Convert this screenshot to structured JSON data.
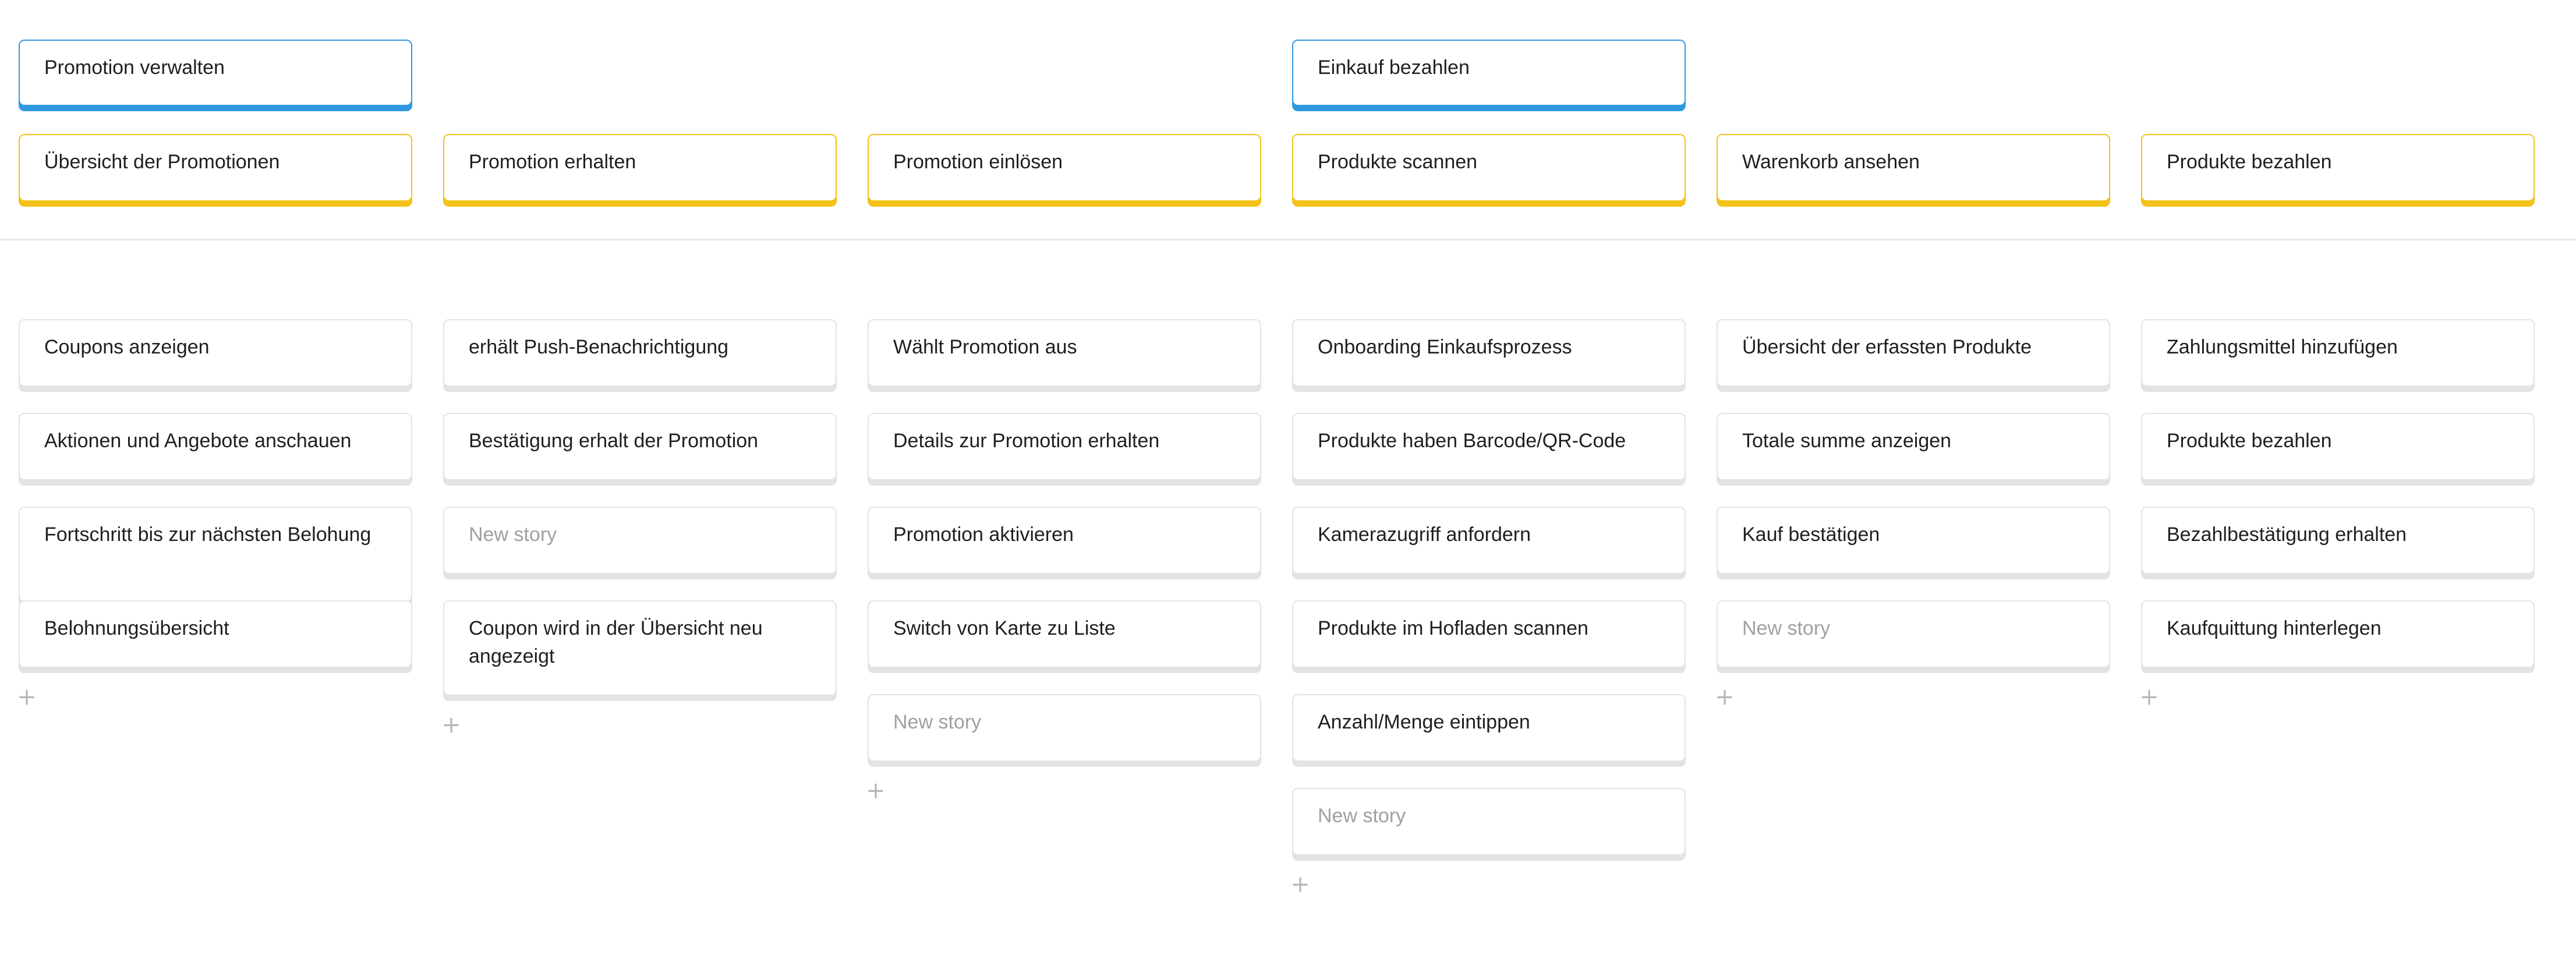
{
  "colors": {
    "activity_accent": "#2f98e0",
    "task_accent": "#f4c21a",
    "card_border": "#e3e3e3",
    "placeholder_text": "#a0a0a0",
    "add_icon": "#b7b7b7"
  },
  "icons": {
    "add": "plus-icon"
  },
  "add_symbol": "+",
  "activities": [
    {
      "label": "Promotion verwalten",
      "column": 0
    },
    {
      "label": "Einkauf bezahlen",
      "column": 3
    }
  ],
  "columns": [
    {
      "task": "Übersicht der Promotionen",
      "stories": [
        {
          "text": "Coupons anzeigen"
        },
        {
          "text": "Aktionen und Angebote anschauen"
        },
        {
          "text": "Fortschritt bis zur nächsten Belohung"
        },
        {
          "text": "Belohnungsübersicht"
        }
      ]
    },
    {
      "task": "Promotion erhalten",
      "stories": [
        {
          "text": "erhält Push-Benachrichtigung"
        },
        {
          "text": "Bestätigung erhalt der Promotion"
        },
        {
          "text": "New story",
          "placeholder": true
        },
        {
          "text": "Coupon wird in der Übersicht neu angezeigt"
        }
      ]
    },
    {
      "task": "Promotion einlösen",
      "stories": [
        {
          "text": "Wählt Promotion aus"
        },
        {
          "text": "Details zur Promotion erhalten"
        },
        {
          "text": "Promotion aktivieren"
        },
        {
          "text": "Switch von Karte zu Liste"
        },
        {
          "text": "New story",
          "placeholder": true
        }
      ]
    },
    {
      "task": "Produkte scannen",
      "stories": [
        {
          "text": "Onboarding Einkaufsprozess"
        },
        {
          "text": "Produkte haben Barcode/QR-Code"
        },
        {
          "text": "Kamerazugriff anfordern"
        },
        {
          "text": "Produkte im Hofladen scannen"
        },
        {
          "text": "Anzahl/Menge eintippen"
        },
        {
          "text": "New story",
          "placeholder": true
        }
      ]
    },
    {
      "task": "Warenkorb ansehen",
      "stories": [
        {
          "text": "Übersicht der erfassten Produkte"
        },
        {
          "text": "Totale summe anzeigen"
        },
        {
          "text": "Kauf bestätigen"
        },
        {
          "text": "New story",
          "placeholder": true
        }
      ]
    },
    {
      "task": "Produkte bezahlen",
      "stories": [
        {
          "text": "Zahlungsmittel hinzufügen"
        },
        {
          "text": "Produkte bezahlen"
        },
        {
          "text": "Bezahlbestätigung erhalten"
        },
        {
          "text": "Kaufquittung hinterlegen"
        }
      ]
    }
  ]
}
